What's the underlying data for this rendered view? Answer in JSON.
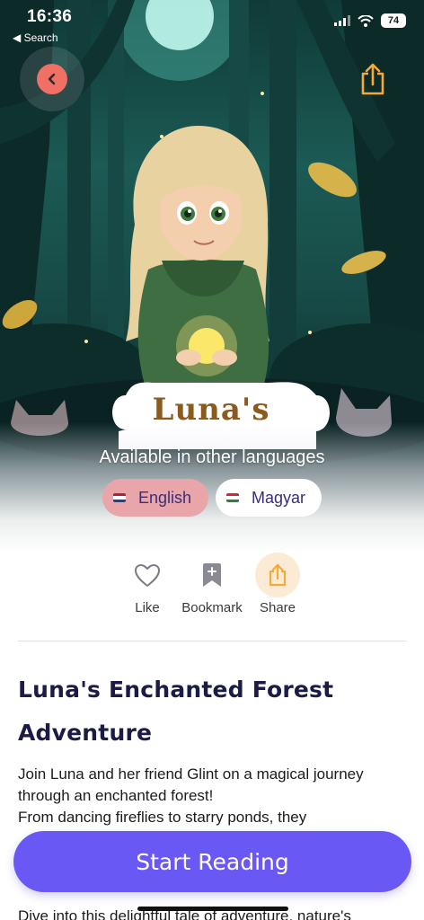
{
  "status_bar": {
    "time": "16:36",
    "back_app": "◀ Search",
    "battery": "74"
  },
  "hero": {
    "cover_text": "Luna's",
    "available_languages_title": "Available in other languages",
    "languages": [
      {
        "label": "English",
        "flag": "us-flag",
        "selected": true
      },
      {
        "label": "Magyar",
        "flag": "hu-flag",
        "selected": false
      }
    ]
  },
  "actions": {
    "like": "Like",
    "bookmark": "Bookmark",
    "share": "Share"
  },
  "book": {
    "title": "Luna's Enchanted Forest Adventure",
    "description": "Join Luna and her friend Glint on a magical journey through an enchanted forest!\nFrom dancing fireflies to starry ponds, they",
    "description_more": "Dive into this delightful tale of adventure, nature's"
  },
  "cta": {
    "start_reading": "Start Reading"
  },
  "colors": {
    "accent": "#6a58f4",
    "back_button": "#f07066",
    "share_accent": "#f5a93a",
    "title_text": "#1c1b45",
    "selected_language": "#e9a6aa"
  }
}
